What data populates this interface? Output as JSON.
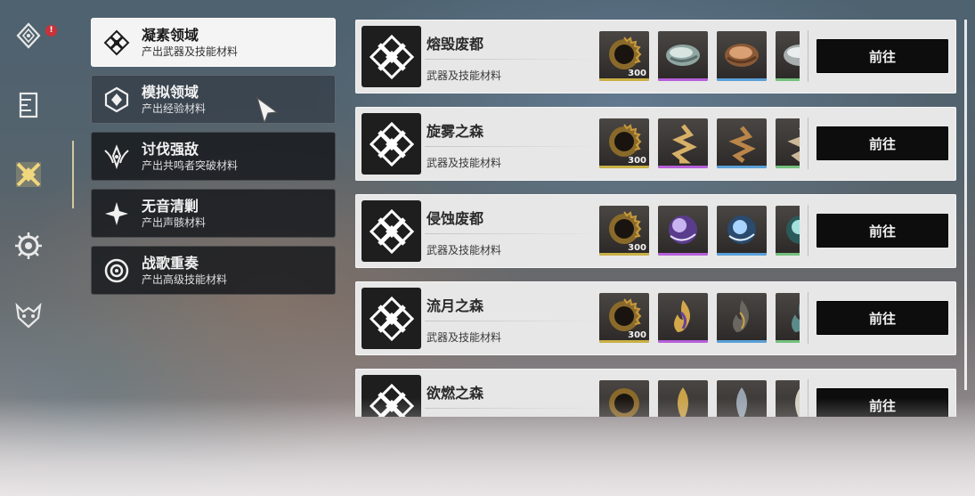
{
  "rail": {
    "badge": "!",
    "icons": [
      "main-diamond-icon",
      "codex-book-icon",
      "crossed-swords-icon",
      "settings-wheel-icon",
      "beast-head-icon"
    ]
  },
  "categories": [
    {
      "title": "凝素领域",
      "subtitle": "产出武器及技能材料",
      "icon": "ornament-icon",
      "state": "active"
    },
    {
      "title": "模拟领域",
      "subtitle": "产出经验材料",
      "icon": "hexagon-icon",
      "state": "hover"
    },
    {
      "title": "讨伐强敌",
      "subtitle": "产出共鸣者突破材料",
      "icon": "wing-emblem-icon",
      "state": "normal"
    },
    {
      "title": "无音清剿",
      "subtitle": "产出声骸材料",
      "icon": "sparkle-icon",
      "state": "normal"
    },
    {
      "title": "战歌重奏",
      "subtitle": "产出高级技能材料",
      "icon": "ring-eye-icon",
      "state": "normal"
    }
  ],
  "domains": [
    {
      "title": "熔毁废都",
      "subtitle": "武器及技能材料",
      "button": "前往",
      "rewards": [
        {
          "name": "shell-credit-icon",
          "qty": "300",
          "bar": "#c9b046"
        },
        {
          "name": "metal-shard-icon",
          "qty": "",
          "bar": "#b65fd9"
        },
        {
          "name": "bronze-shard-icon",
          "qty": "",
          "bar": "#5aa0d8"
        },
        {
          "name": "silver-shard-icon",
          "qty": "",
          "bar": "#74c07d"
        }
      ]
    },
    {
      "title": "旋雾之森",
      "subtitle": "武器及技能材料",
      "button": "前往",
      "rewards": [
        {
          "name": "shell-credit-icon",
          "qty": "300",
          "bar": "#c9b046"
        },
        {
          "name": "spiral-gold-icon",
          "qty": "",
          "bar": "#b65fd9"
        },
        {
          "name": "spiral-bronze-icon",
          "qty": "",
          "bar": "#5aa0d8"
        },
        {
          "name": "spiral-pale-icon",
          "qty": "",
          "bar": "#74c07d"
        }
      ]
    },
    {
      "title": "侵蚀废都",
      "subtitle": "武器及技能材料",
      "button": "前往",
      "rewards": [
        {
          "name": "shell-credit-icon",
          "qty": "300",
          "bar": "#c9b046"
        },
        {
          "name": "violet-orb-icon",
          "qty": "",
          "bar": "#b65fd9"
        },
        {
          "name": "blue-orb-icon",
          "qty": "",
          "bar": "#5aa0d8"
        },
        {
          "name": "teal-orb-icon",
          "qty": "",
          "bar": "#74c07d"
        }
      ]
    },
    {
      "title": "流月之森",
      "subtitle": "武器及技能材料",
      "button": "前往",
      "rewards": [
        {
          "name": "shell-credit-icon",
          "qty": "300",
          "bar": "#c9b046"
        },
        {
          "name": "violet-flame-icon",
          "qty": "",
          "bar": "#b65fd9"
        },
        {
          "name": "dark-flame-icon",
          "qty": "",
          "bar": "#5aa0d8"
        },
        {
          "name": "teal-flame-icon",
          "qty": "",
          "bar": "#74c07d"
        }
      ]
    },
    {
      "title": "欲燃之森",
      "subtitle": "",
      "button": "前往",
      "rewards": [
        {
          "name": "shell-credit-icon",
          "qty": "",
          "bar": "#c9b046"
        },
        {
          "name": "gold-leaf-icon",
          "qty": "",
          "bar": "#b65fd9"
        },
        {
          "name": "steel-leaf-icon",
          "qty": "",
          "bar": "#5aa0d8"
        },
        {
          "name": "pale-leaf-icon",
          "qty": "",
          "bar": "#74c07d"
        }
      ]
    }
  ]
}
